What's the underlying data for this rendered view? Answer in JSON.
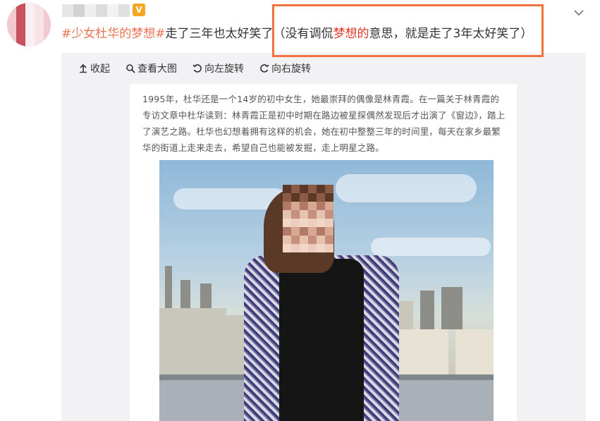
{
  "post": {
    "username_masked": "",
    "verified_badge": "V",
    "hashtag": "#少女杜华的梦想#",
    "text_after_tag": "走了三年也太好笑了",
    "paren_open": "（没有调侃",
    "paren_highlight": "梦想的",
    "paren_rest": "意思，就是走了3年太好笑了）"
  },
  "toolbar": {
    "collapse": "收起",
    "view_large": "查看大图",
    "rotate_left": "向左旋转",
    "rotate_right": "向右旋转"
  },
  "article": {
    "paragraph": "1995年，杜华还是一个14岁的初中女生，她最崇拜的偶像是林青霞。在一篇关于林青霞的专访文章中杜华读到：林青霞正是初中时期在路边被星探偶然发现后才出演了《窗边》，踏上了演艺之路。杜华也幻想着拥有这样的机会，她在初中整整三年的时间里，每天在家乡最繁华的街道上走来走去，希望自己也能被发掘，走上明星之路。"
  },
  "colors": {
    "accent_orange": "#f0733c",
    "link_orange": "#eb7350",
    "highlight_red": "#e2362d",
    "panel_gray": "#f2f2f5",
    "badge": "#f5a623"
  },
  "icons": [
    "chevron-down-icon",
    "collapse-arrow-icon",
    "search-icon",
    "rotate-left-icon",
    "rotate-right-icon"
  ]
}
